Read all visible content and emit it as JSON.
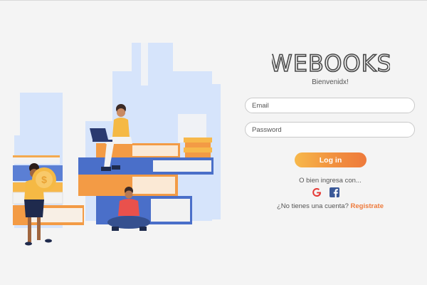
{
  "brand": {
    "logo_text": "WEBOOKS"
  },
  "login": {
    "welcome": "Bienvenidx!",
    "email_placeholder": "Email",
    "password_placeholder": "Password",
    "login_label": "Log in",
    "alt_text": "O bien ingresa con...",
    "social": [
      "google-icon",
      "facebook-icon"
    ],
    "signup_prompt": "¿No tienes una cuenta?",
    "signup_link": "Registrate"
  },
  "colors": {
    "accent_orange": "#ee7a3b",
    "accent_yellow": "#f7b84b",
    "book_blue": "#4a6fc9",
    "sky_blue": "#cfe0fb",
    "background": "#f4f4f4"
  }
}
